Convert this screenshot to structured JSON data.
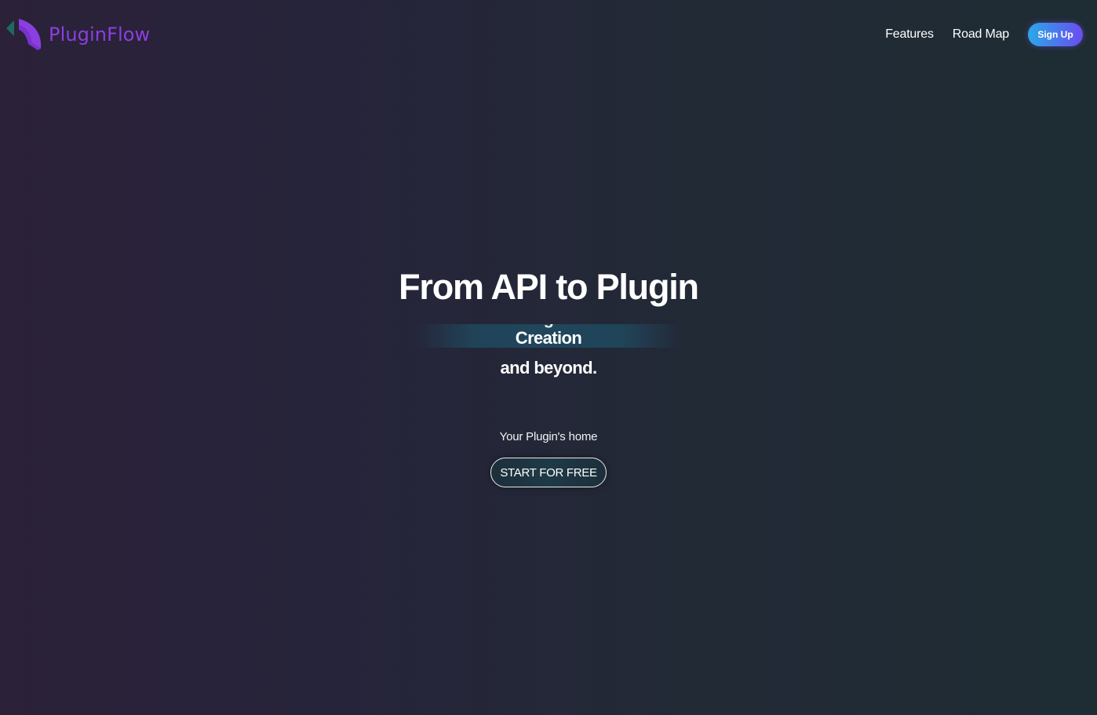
{
  "brand": {
    "name": "PluginFlow",
    "logo_icon": "pluginflow-logo-icon",
    "color": "#8b3fe0"
  },
  "nav": {
    "links": [
      {
        "label": "Features"
      },
      {
        "label": "Road Map"
      }
    ],
    "signup_label": "Sign Up",
    "signup_gradient": [
      "#2aa9e8",
      "#6a4cf0"
    ]
  },
  "hero": {
    "title": "From API to Plugin",
    "rotating_word": "Creation",
    "subtitle": "and beyond.",
    "tagline": "Your Plugin's home",
    "cta_label": "START FOR FREE"
  },
  "colors": {
    "background_left": "#2b2139",
    "background_right": "#1e2c33",
    "highlight_band": "#20485e"
  }
}
